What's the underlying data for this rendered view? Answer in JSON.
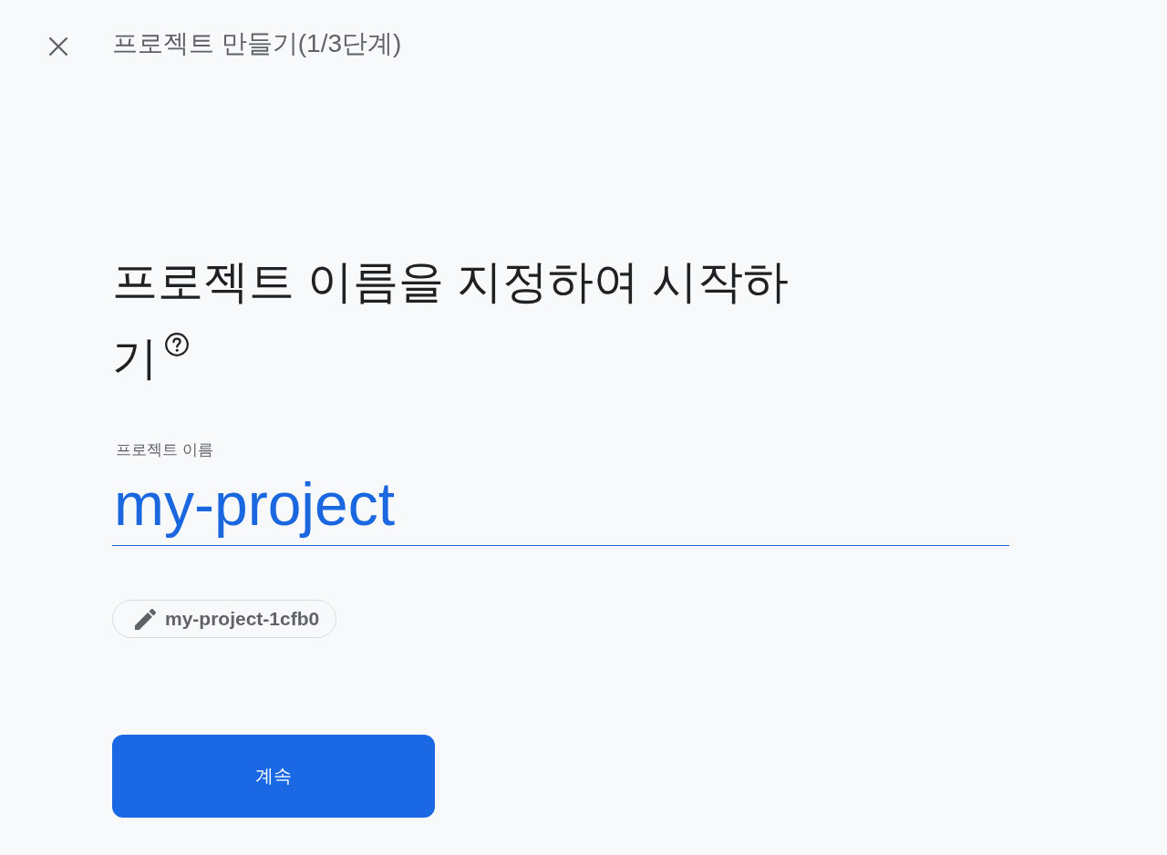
{
  "header": {
    "title": "프로젝트 만들기(1/3단계)"
  },
  "heading": {
    "lines": [
      "프로젝트 이름을 지정하여 시작하",
      "기"
    ]
  },
  "project_name_field": {
    "label": "프로젝트 이름",
    "value": "my-project"
  },
  "project_id_chip": {
    "text": "my-project-1cfb0"
  },
  "continue_button": {
    "label": "계속"
  }
}
